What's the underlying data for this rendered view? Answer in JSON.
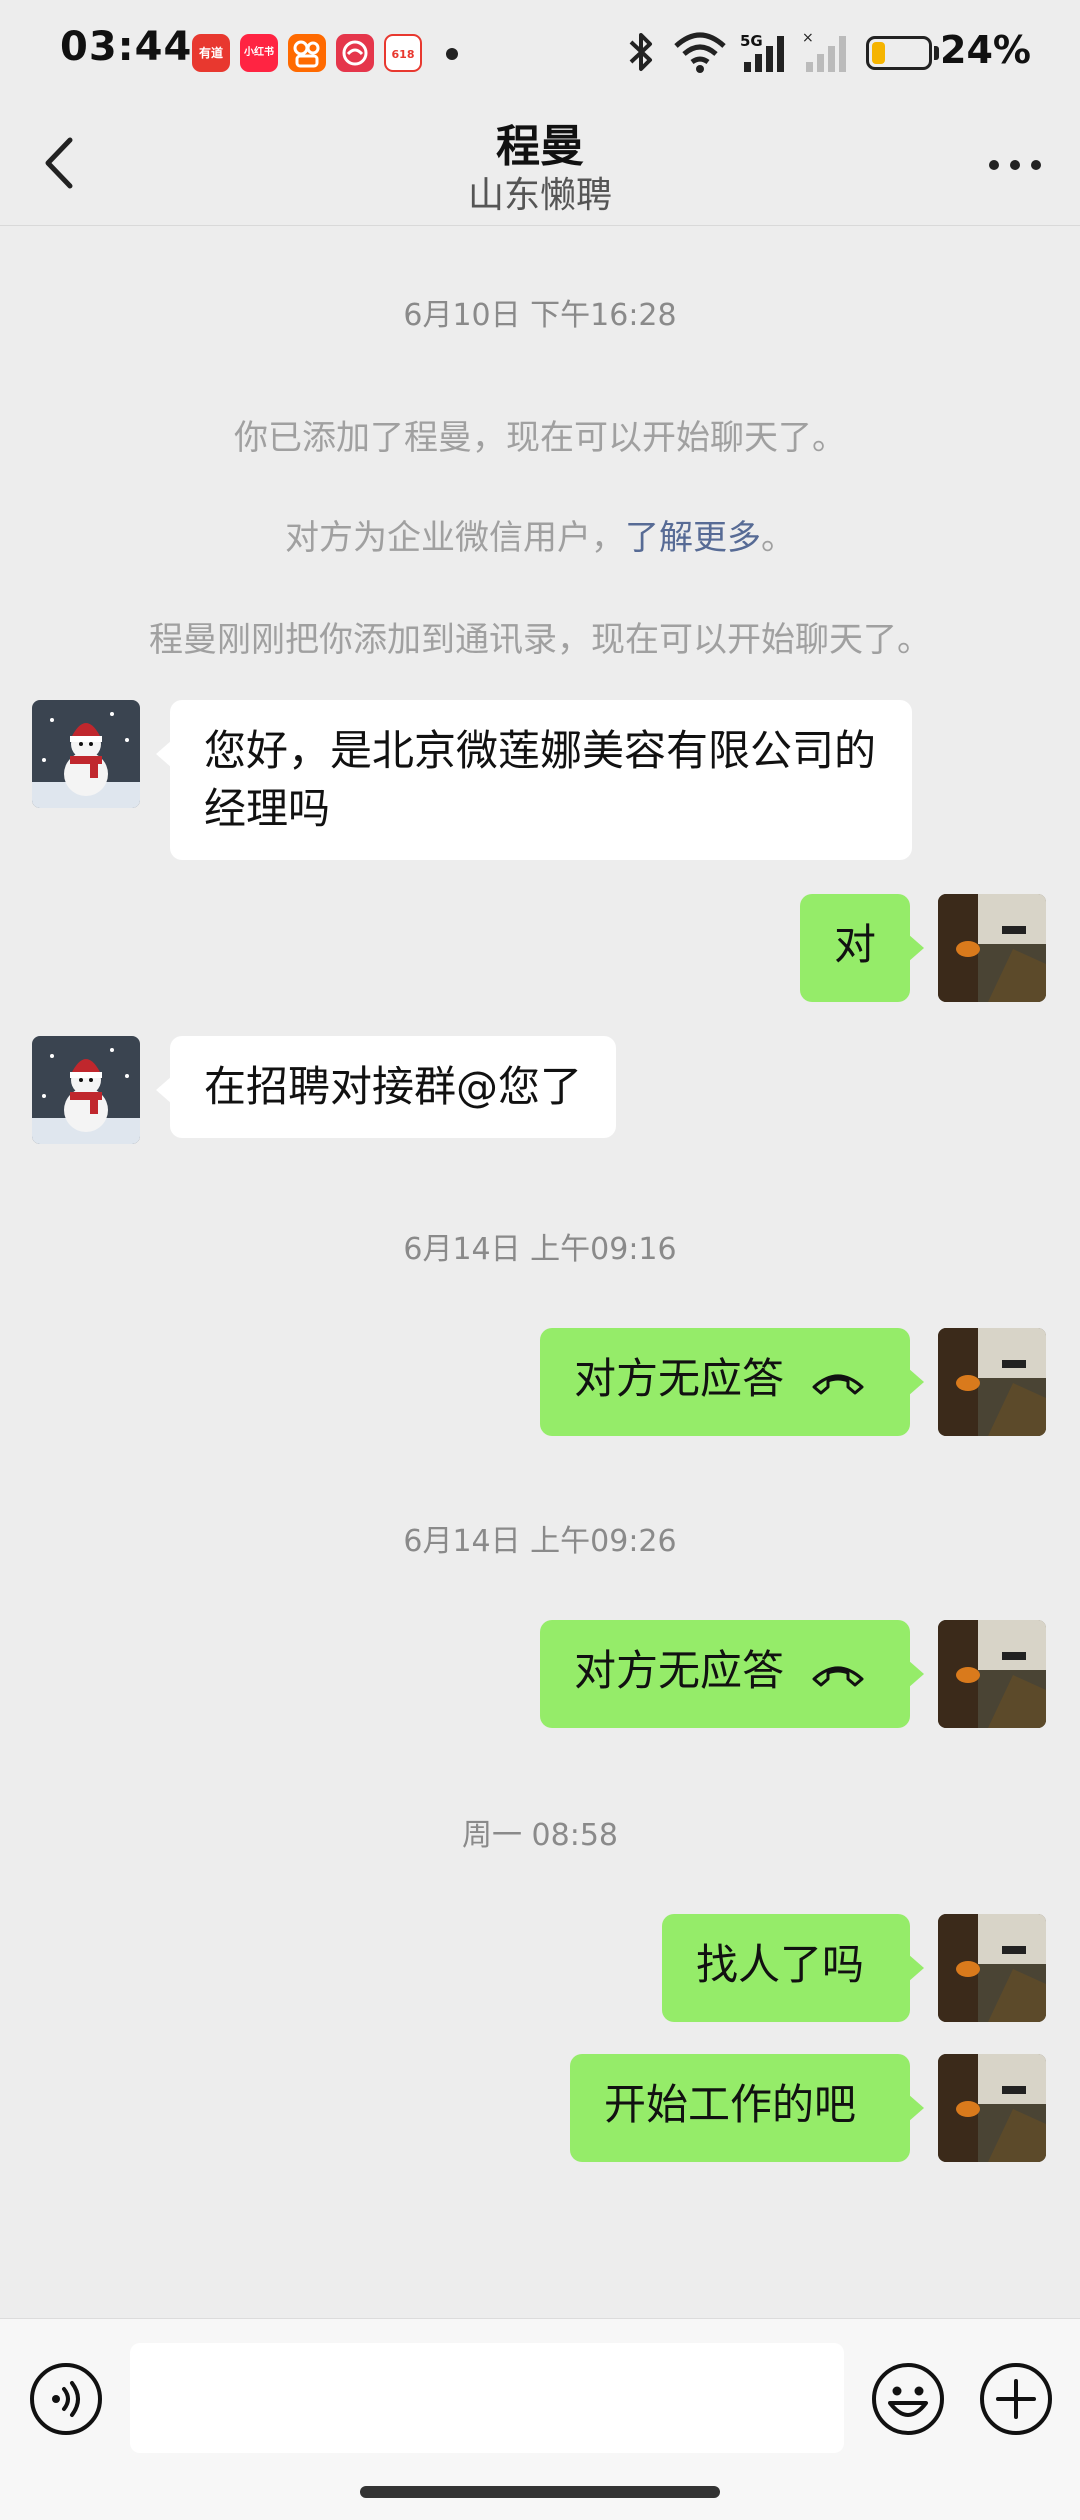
{
  "status_bar": {
    "time": "03:44",
    "app_icons": [
      {
        "name": "youdao-app-icon",
        "label": "有道"
      },
      {
        "name": "xiaohongshu-app-icon",
        "label": "小红书"
      },
      {
        "name": "kuaishou-app-icon",
        "label": ""
      },
      {
        "name": "app-icon-red",
        "label": ""
      },
      {
        "name": "taobao-app-icon",
        "label": "618"
      }
    ],
    "network": "5G",
    "battery_percent": "24%",
    "battery_level": 0.24
  },
  "header": {
    "title": "程曼",
    "subtitle": "山东懒聘"
  },
  "chat": {
    "ts1": "6月10日 下午16:28",
    "sys1": "你已添加了程曼，现在可以开始聊天了。",
    "sys2_text": "对方为企业微信用户，",
    "sys2_link": "了解更多",
    "sys2_end": "。",
    "sys3": "程曼刚刚把你添加到通讯录，现在可以开始聊天了。",
    "msg1": "您好，是北京微莲娜美容有限公司的经理吗",
    "msg2": "对",
    "msg3": "在招聘对接群@您了",
    "ts2": "6月14日 上午09:16",
    "call1": "对方无应答",
    "ts3": "6月14日 上午09:26",
    "call2": "对方无应答",
    "ts4": "周一 08:58",
    "msg4": "找人了吗",
    "msg5": "开始工作的吧"
  },
  "input_bar": {
    "placeholder": ""
  },
  "colors": {
    "background": "#ededed",
    "bubble_right": "#95ec69",
    "bubble_left": "#ffffff",
    "link": "#576b95"
  }
}
